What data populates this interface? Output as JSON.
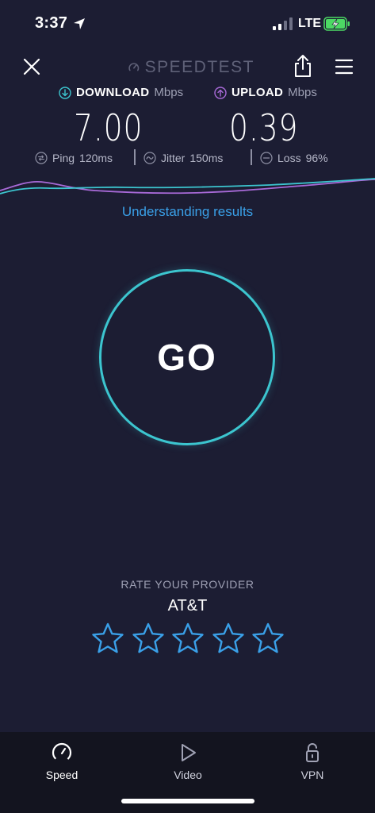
{
  "status_bar": {
    "time": "3:37",
    "network": "LTE",
    "icons": [
      "location-arrow-icon",
      "signal-bars-icon",
      "battery-charging-icon"
    ]
  },
  "header": {
    "logo_text": "SPEEDTEST",
    "icons": [
      "close-icon",
      "speedometer-icon",
      "share-icon",
      "hamburger-menu-icon"
    ]
  },
  "results": {
    "download": {
      "label": "DOWNLOAD",
      "unit": "Mbps",
      "value": "7.00",
      "icon": "download-arrow-icon"
    },
    "upload": {
      "label": "UPLOAD",
      "unit": "Mbps",
      "value": "0.39",
      "icon": "upload-arrow-icon"
    },
    "ping": {
      "label": "Ping",
      "value": "120",
      "unit": "ms",
      "icon": "ping-icon"
    },
    "jitter": {
      "label": "Jitter",
      "value": "150",
      "unit": "ms",
      "icon": "jitter-icon"
    },
    "loss": {
      "label": "Loss",
      "value": "96",
      "unit": "%",
      "icon": "loss-icon"
    }
  },
  "understanding_link": "Understanding results",
  "go_button": {
    "label": "GO"
  },
  "rating": {
    "title": "RATE YOUR PROVIDER",
    "provider": "AT&T",
    "stars_total": 5,
    "stars_filled": 0
  },
  "tabs": [
    {
      "label": "Speed",
      "icon": "speedometer-icon",
      "active": true
    },
    {
      "label": "Video",
      "icon": "play-icon",
      "active": false
    },
    {
      "label": "VPN",
      "icon": "lock-icon",
      "active": false
    }
  ],
  "colors": {
    "background": "#1c1d33",
    "tab_bar": "#13141f",
    "download_accent": "#3cc5cf",
    "upload_accent": "#a86ad8",
    "link": "#3aa0e8",
    "star": "#3aa0e8",
    "battery": "#4cd964"
  }
}
